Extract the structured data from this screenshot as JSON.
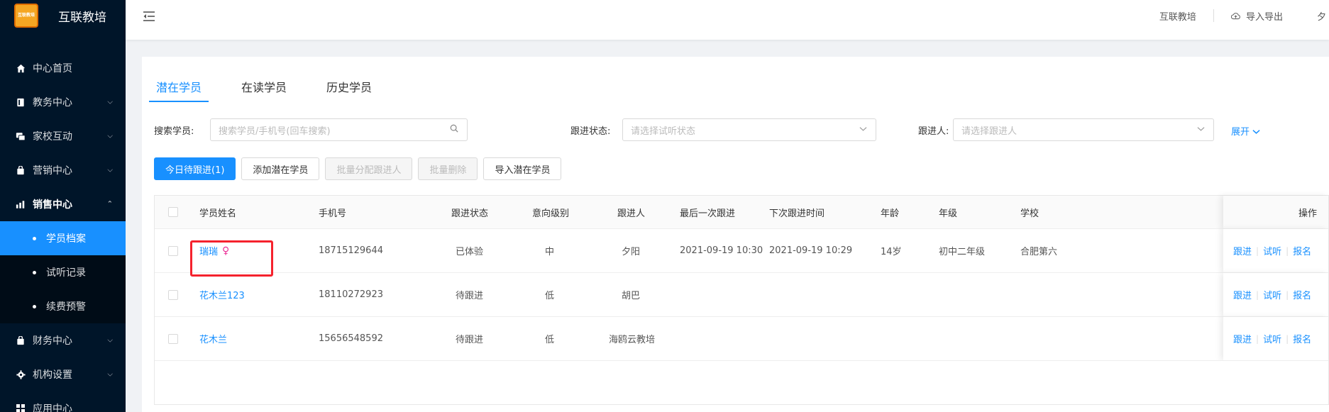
{
  "app": {
    "brand_name": "互联教培",
    "logo_text": "互联教培"
  },
  "sidebar": {
    "items": [
      {
        "label": "中心首页",
        "icon": "home-icon"
      },
      {
        "label": "教务中心",
        "icon": "book-icon"
      },
      {
        "label": "家校互动",
        "icon": "chat-icon"
      },
      {
        "label": "营销中心",
        "icon": "bag-icon"
      },
      {
        "label": "销售中心",
        "icon": "sales-icon"
      },
      {
        "label": "财务中心",
        "icon": "wallet-icon"
      },
      {
        "label": "机构设置",
        "icon": "gear-icon"
      },
      {
        "label": "应用中心",
        "icon": "grid-icon"
      }
    ],
    "sub_items": [
      {
        "label": "学员档案"
      },
      {
        "label": "试听记录"
      },
      {
        "label": "续费预警"
      }
    ]
  },
  "header": {
    "org_name": "互联教培",
    "import_export": "导入导出",
    "truncated": "夕"
  },
  "tabs": [
    {
      "label": "潜在学员",
      "active": true
    },
    {
      "label": "在读学员",
      "active": false
    },
    {
      "label": "历史学员",
      "active": false
    }
  ],
  "filters": {
    "search_label": "搜索学员:",
    "search_placeholder": "搜索学员/手机号(回车搜索)",
    "status_label": "跟进状态:",
    "status_placeholder": "请选择试听状态",
    "follower_label": "跟进人:",
    "follower_placeholder": "请选择跟进人",
    "expand_label": "展开"
  },
  "actions": {
    "today_follow": "今日待跟进(1)",
    "add_potential": "添加潜在学员",
    "batch_assign": "批量分配跟进人",
    "batch_delete": "批量删除",
    "import_potential": "导入潜在学员"
  },
  "table": {
    "headers": {
      "name": "学员姓名",
      "phone": "手机号",
      "status": "跟进状态",
      "intent": "意向级别",
      "follower": "跟进人",
      "last_follow": "最后一次跟进",
      "next_follow": "下次跟进时间",
      "age": "年龄",
      "grade": "年级",
      "school": "学校",
      "ops": "操作"
    },
    "rows": [
      {
        "name": "瑞瑞",
        "gender": "♀",
        "phone": "18715129644",
        "status": "已体验",
        "intent": "中",
        "follower": "夕阳",
        "last_follow": "2021-09-19 10:30",
        "next_follow": "2021-09-19 10:29",
        "age": "14岁",
        "grade": "初中二年级",
        "school": "合肥第六"
      },
      {
        "name": "花木兰123",
        "gender": "",
        "phone": "18110272923",
        "status": "待跟进",
        "intent": "低",
        "follower": "胡巴",
        "last_follow": "",
        "next_follow": "",
        "age": "",
        "grade": "",
        "school": ""
      },
      {
        "name": "花木兰",
        "gender": "",
        "phone": "15656548592",
        "status": "待跟进",
        "intent": "低",
        "follower": "海鸥云教培",
        "last_follow": "",
        "next_follow": "",
        "age": "",
        "grade": "",
        "school": ""
      }
    ],
    "op_links": {
      "follow": "跟进",
      "trial": "试听",
      "enroll": "报名"
    }
  },
  "colors": {
    "primary": "#1890ff",
    "sidebar_bg": "#001529",
    "highlight": "#f5222d",
    "female": "#eb2f96"
  }
}
